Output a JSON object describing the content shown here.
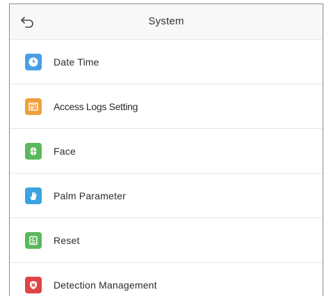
{
  "header": {
    "title": "System",
    "back_icon": "back-arrow-icon"
  },
  "menu": {
    "items": [
      {
        "label": "Date Time",
        "icon": "clock-icon",
        "color": "#4a9ee8"
      },
      {
        "label": "Access Logs Setting",
        "icon": "logs-icon",
        "color": "#f0a03c"
      },
      {
        "label": "Face",
        "icon": "face-icon",
        "color": "#5cb85c"
      },
      {
        "label": "Palm Parameter",
        "icon": "palm-icon",
        "color": "#3aa3e0"
      },
      {
        "label": "Reset",
        "icon": "reset-icon",
        "color": "#5cb85c"
      },
      {
        "label": "Detection Management",
        "icon": "shield-icon",
        "color": "#e04444"
      }
    ]
  }
}
